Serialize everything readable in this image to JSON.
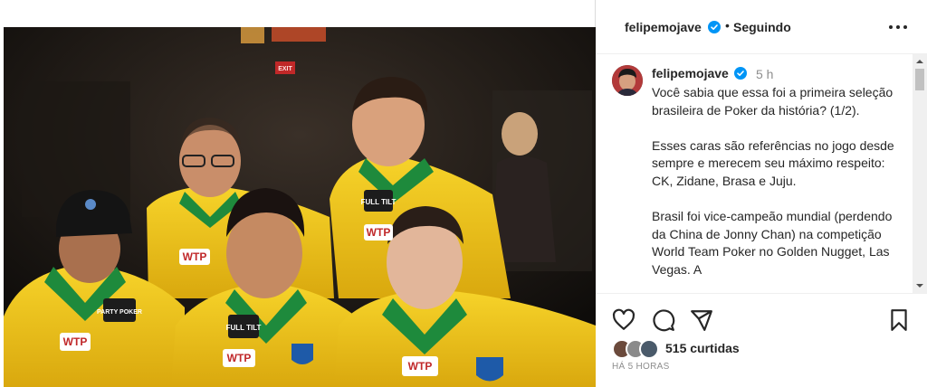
{
  "post": {
    "username": "felipemojave",
    "separator": "•",
    "follow_status": "Seguindo",
    "more_icon": "more-horizontal-icon"
  },
  "caption": {
    "username": "felipemojave",
    "time": "5 h",
    "paragraphs": [
      "Você sabia que essa foi a primeira seleção brasileira de Poker da história? (1/2).",
      "Esses caras são referências no jogo desde sempre e merecem seu máximo respeito: CK, Zidane, Brasa e Juju.",
      "Brasil foi vice-campeão mundial (perdendo da China de Jonny Chan) na competição World Team Poker no Golden Nugget, Las Vegas. A"
    ]
  },
  "photo": {
    "jersey_logos": [
      "WTP",
      "FULL TILT",
      "WTP",
      "FULL TILT",
      "WTP",
      "FULL TILT",
      "WTP",
      "PARTY POKER"
    ],
    "sign_text": "EXIT"
  },
  "actions": {
    "like_icon": "heart-icon",
    "comment_icon": "comment-icon",
    "share_icon": "send-icon",
    "save_icon": "bookmark-icon",
    "likes_text": "515 curtidas",
    "posted_ago": "HÁ 5 HORAS"
  },
  "colors": {
    "verified": "#0095f6",
    "text": "#262626",
    "muted": "#8e8e8e",
    "jersey_yellow": "#f2c416",
    "jersey_green": "#1e8a3c"
  }
}
